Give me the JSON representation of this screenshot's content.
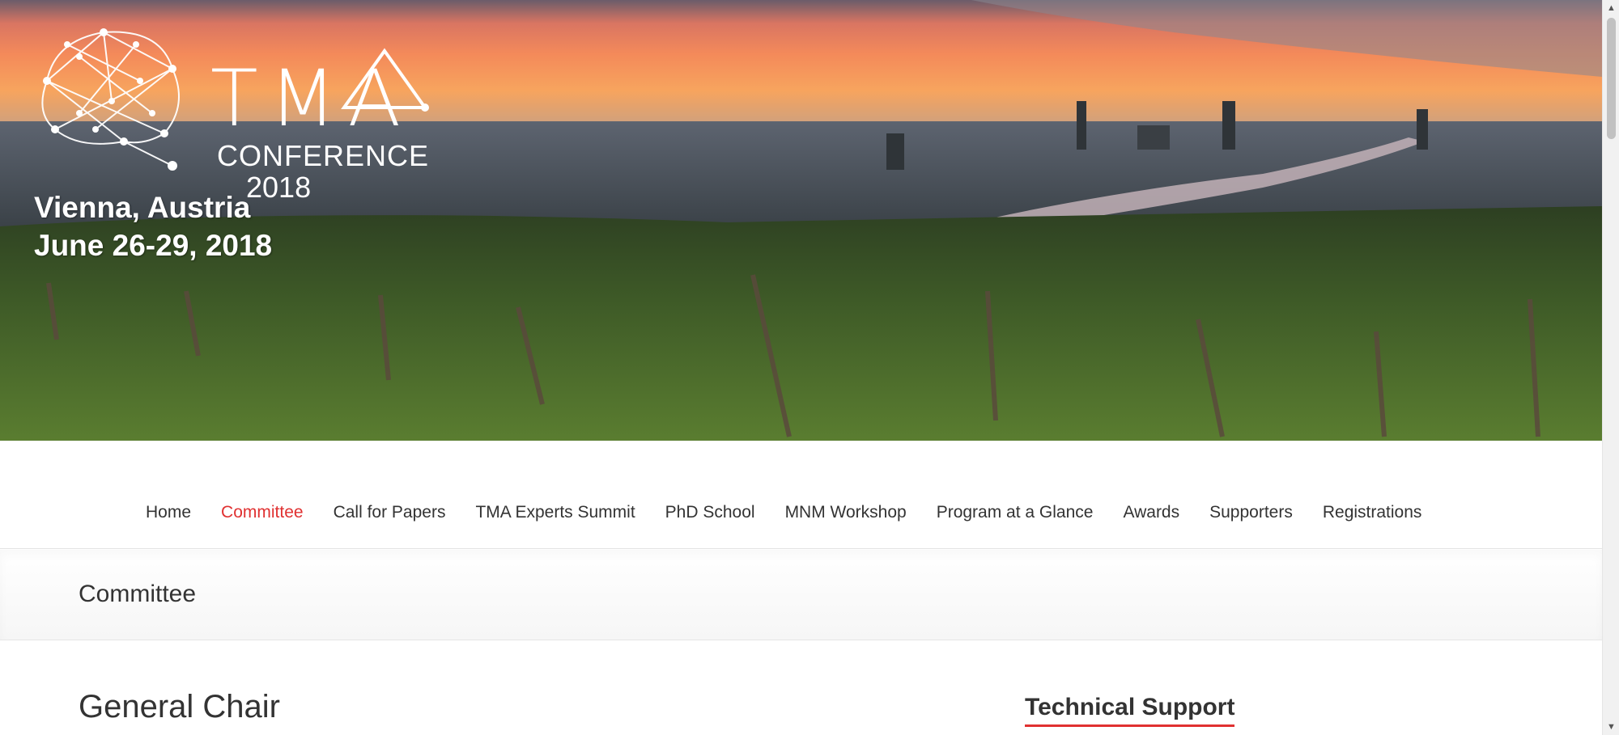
{
  "banner": {
    "logo_title": "TMA",
    "logo_subtitle": "CONFERENCE",
    "logo_year": "2018",
    "location": "Vienna, Austria",
    "dates": "June 26-29, 2018"
  },
  "nav": {
    "items": [
      {
        "label": "Home",
        "active": false
      },
      {
        "label": "Committee",
        "active": true
      },
      {
        "label": "Call for Papers",
        "active": false
      },
      {
        "label": "TMA Experts Summit",
        "active": false
      },
      {
        "label": "PhD School",
        "active": false
      },
      {
        "label": "MNM Workshop",
        "active": false
      },
      {
        "label": "Program at a Glance",
        "active": false
      },
      {
        "label": "Awards",
        "active": false
      },
      {
        "label": "Supporters",
        "active": false
      },
      {
        "label": "Registrations",
        "active": false
      }
    ],
    "active_color": "#e03131"
  },
  "page": {
    "title": "Committee"
  },
  "content": {
    "section_heading": "General Chair"
  },
  "sidebar": {
    "widget_title": "Technical Support"
  },
  "colors": {
    "accent": "#e03131",
    "text": "#333333"
  }
}
